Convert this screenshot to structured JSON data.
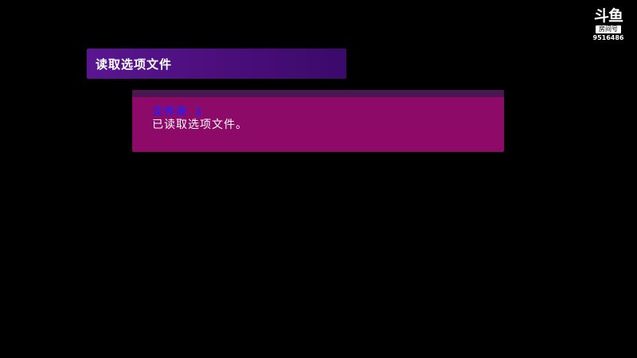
{
  "header": {
    "title": "读取选项文件"
  },
  "message": {
    "folder_label": "文件夹 1",
    "body": "已读取选项文件。"
  },
  "watermark": {
    "logo_text": "斗鱼",
    "tag": "房间号",
    "room_id": "9516486"
  },
  "colors": {
    "background": "#000000",
    "header_bar": "#4a0e7a",
    "message_panel": "#8e0a68",
    "message_panel_top": "#4a1850",
    "folder_text": "#2c1cf0",
    "body_text": "#ffffff"
  }
}
